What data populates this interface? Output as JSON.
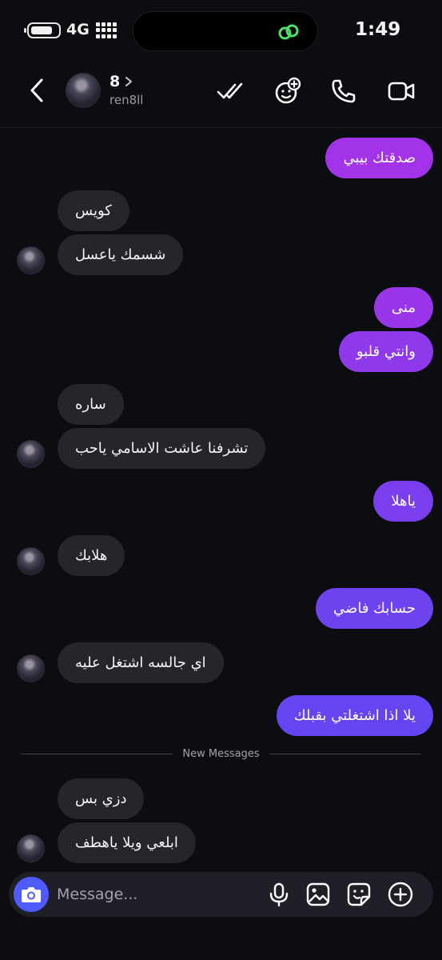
{
  "status_bar": {
    "network": "4G",
    "time": "1:49"
  },
  "contact": {
    "name": "8",
    "username": "ren8ll"
  },
  "messages": [
    {
      "id": "m1",
      "text": "صدقتك بيبي",
      "direction": "out",
      "color": "#a233e8"
    },
    {
      "id": "m2",
      "text": "كويس",
      "direction": "in"
    },
    {
      "id": "m3",
      "text": "شسمك ياعسل",
      "direction": "in"
    },
    {
      "id": "m4",
      "text": "منى",
      "direction": "out",
      "color": "#9a36e9"
    },
    {
      "id": "m5",
      "text": "وانتي قلبو",
      "direction": "out",
      "color": "#8f3aea"
    },
    {
      "id": "m6",
      "text": "ساره",
      "direction": "in"
    },
    {
      "id": "m7",
      "text": "تشرفنا عاشت الاسامي ياحب",
      "direction": "in"
    },
    {
      "id": "m8",
      "text": "ياهلا",
      "direction": "out",
      "color": "#7a3eee"
    },
    {
      "id": "m9",
      "text": "هلابك",
      "direction": "in"
    },
    {
      "id": "m10",
      "text": "حسابك فاضي",
      "direction": "out",
      "color": "#6f42f0"
    },
    {
      "id": "m11",
      "text": "اي جالسه اشتغل عليه",
      "direction": "in"
    },
    {
      "id": "m12",
      "text": "يلا اذا اشتغلتي بقبلك",
      "direction": "out",
      "color": "#6545f2"
    },
    {
      "id": "m13",
      "text": "دزي بس",
      "direction": "in"
    },
    {
      "id": "m14",
      "text": "ابلعي ويلا ياهطف",
      "direction": "in"
    }
  ],
  "divider_label": "New Messages",
  "composer": {
    "placeholder": "Message..."
  },
  "colors": {
    "background": "#0c0d11",
    "incoming_bubble": "#25262c",
    "camera_button": "#4f5bff"
  },
  "icons": [
    "back-icon",
    "chevron-right-icon",
    "double-check-icon",
    "sticker-add-icon",
    "phone-icon",
    "video-icon",
    "camera-icon",
    "mic-icon",
    "image-icon",
    "sticker-icon",
    "plus-circle-icon"
  ]
}
